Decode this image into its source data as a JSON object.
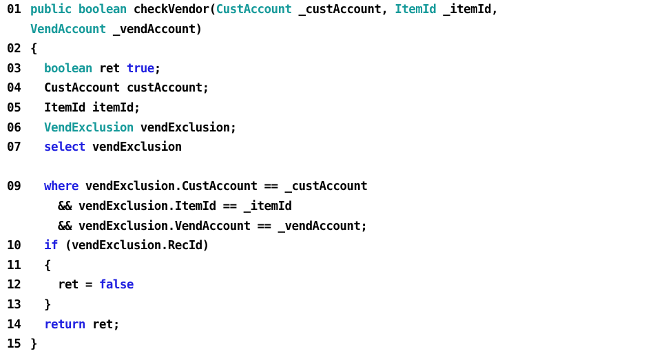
{
  "listing": {
    "title": "checkVendor method source listing",
    "language": "X++",
    "colors": {
      "background": "#ffffff",
      "default_text": "#000000",
      "keyword": "#1f1fe0",
      "type": "#169a9a",
      "line_number": "#000000"
    },
    "lines": [
      {
        "number": "01",
        "indent": 0,
        "tokens": [
          {
            "text": "public boolean ",
            "kind": "type"
          },
          {
            "text": "checkVendor(",
            "kind": "plain"
          },
          {
            "text": "CustAccount",
            "kind": "type"
          },
          {
            "text": " _custAccount, ",
            "kind": "plain"
          },
          {
            "text": "ItemId",
            "kind": "type"
          },
          {
            "text": " _itemId,",
            "kind": "plain"
          }
        ]
      },
      {
        "number": "",
        "indent": 0,
        "tokens": [
          {
            "text": "VendAccount",
            "kind": "type"
          },
          {
            "text": " _vendAccount)",
            "kind": "plain"
          }
        ]
      },
      {
        "number": "02",
        "indent": 0,
        "tokens": [
          {
            "text": "{",
            "kind": "plain"
          }
        ]
      },
      {
        "number": "03",
        "indent": 2,
        "tokens": [
          {
            "text": "boolean",
            "kind": "type"
          },
          {
            "text": " ret ",
            "kind": "plain"
          },
          {
            "text": "true",
            "kind": "keyword"
          },
          {
            "text": ";",
            "kind": "plain"
          }
        ]
      },
      {
        "number": "04",
        "indent": 2,
        "tokens": [
          {
            "text": "CustAccount custAccount;",
            "kind": "plain"
          }
        ]
      },
      {
        "number": "05",
        "indent": 2,
        "tokens": [
          {
            "text": "ItemId itemId;",
            "kind": "plain"
          }
        ]
      },
      {
        "number": "06",
        "indent": 2,
        "tokens": [
          {
            "text": "VendExclusion",
            "kind": "type"
          },
          {
            "text": " vendExclusion;",
            "kind": "plain"
          }
        ]
      },
      {
        "number": "07",
        "indent": 2,
        "tokens": [
          {
            "text": "select",
            "kind": "keyword"
          },
          {
            "text": " vendExclusion",
            "kind": "plain"
          }
        ]
      },
      {
        "number": "",
        "indent": 0,
        "blank": true,
        "tokens": []
      },
      {
        "number": "09",
        "indent": 2,
        "tokens": [
          {
            "text": "where",
            "kind": "keyword"
          },
          {
            "text": " vendExclusion.CustAccount == _custAccount",
            "kind": "plain"
          }
        ]
      },
      {
        "number": "",
        "indent": 4,
        "tokens": [
          {
            "text": "&& vendExclusion.ItemId == _itemId",
            "kind": "plain"
          }
        ]
      },
      {
        "number": "",
        "indent": 4,
        "tokens": [
          {
            "text": "&& vendExclusion.VendAccount == _vendAccount;",
            "kind": "plain"
          }
        ]
      },
      {
        "number": "10",
        "indent": 2,
        "tokens": [
          {
            "text": "if",
            "kind": "keyword"
          },
          {
            "text": " (vendExclusion.RecId)",
            "kind": "plain"
          }
        ]
      },
      {
        "number": "11",
        "indent": 2,
        "tokens": [
          {
            "text": "{",
            "kind": "plain"
          }
        ]
      },
      {
        "number": "12",
        "indent": 4,
        "tokens": [
          {
            "text": "ret = ",
            "kind": "plain"
          },
          {
            "text": "false",
            "kind": "keyword"
          }
        ]
      },
      {
        "number": "13",
        "indent": 2,
        "tokens": [
          {
            "text": "}",
            "kind": "plain"
          }
        ]
      },
      {
        "number": "14",
        "indent": 2,
        "tokens": [
          {
            "text": "return",
            "kind": "keyword"
          },
          {
            "text": " ret;",
            "kind": "plain"
          }
        ]
      },
      {
        "number": "15",
        "indent": 0,
        "tokens": [
          {
            "text": "}",
            "kind": "plain"
          }
        ]
      }
    ]
  }
}
